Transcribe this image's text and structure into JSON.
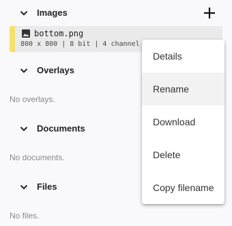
{
  "sections": {
    "images": {
      "title": "Images"
    },
    "overlays": {
      "title": "Overlays",
      "empty_text": "No overlays."
    },
    "documents": {
      "title": "Documents",
      "empty_text": "No documents."
    },
    "files": {
      "title": "Files",
      "empty_text": "No files."
    }
  },
  "image_file": {
    "name": "bottom.png",
    "meta": "800 x 800 | 8 bit | 4 channel"
  },
  "context_menu": {
    "items": [
      {
        "label": "Details"
      },
      {
        "label": "Rename"
      },
      {
        "label": "Download"
      },
      {
        "label": "Delete"
      },
      {
        "label": "Copy filename"
      }
    ],
    "highlighted_index": 1
  },
  "colors": {
    "accent_bar": "#f3e26b",
    "background": "#f9f9fb",
    "menu_hover": "#f2f2f2"
  },
  "icons": {
    "section_toggle": "chevron-down-icon",
    "add": "plus-icon",
    "image": "image-icon"
  }
}
